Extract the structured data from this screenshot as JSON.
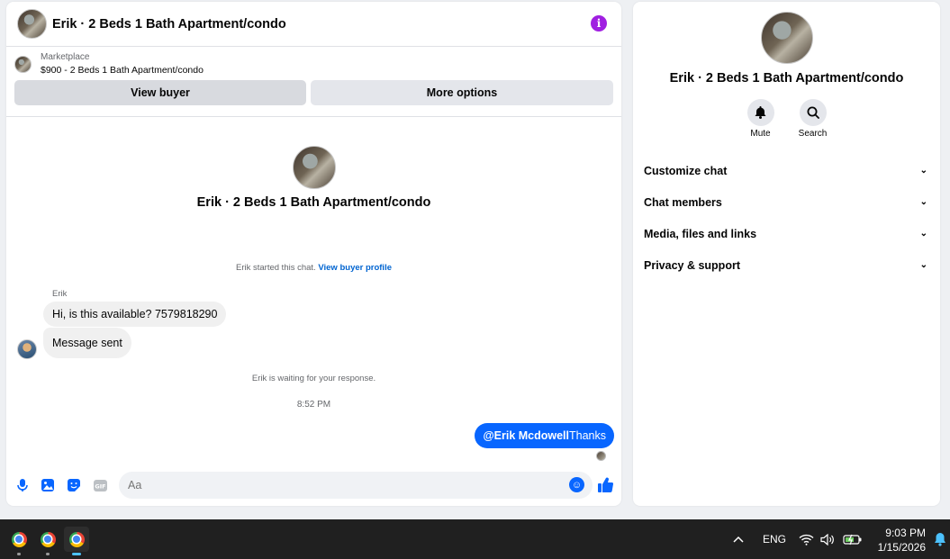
{
  "chat": {
    "header_title": "Erik · 2 Beds 1 Bath Apartment/condo",
    "marketplace": {
      "label": "Marketplace",
      "listing": "$900 - 2 Beds 1 Bath Apartment/condo",
      "view_buyer": "View buyer",
      "more_options": "More options"
    },
    "conversation_name": "Erik · 2 Beds 1 Bath Apartment/condo",
    "started_text": "Erik started this chat.",
    "view_profile_link": "View buyer profile",
    "sender_name": "Erik",
    "messages_in": [
      "Hi, is this available? 7579818290",
      "Message sent"
    ],
    "waiting_text": "Erik is waiting for your response.",
    "timestamp": "8:52 PM",
    "message_out_mention": "@Erik Mcdowell",
    "message_out_text": "Thanks",
    "composer_placeholder": "Aa"
  },
  "side": {
    "name": "Erik · 2 Beds 1 Bath Apartment/condo",
    "actions": [
      "Mute",
      "Search"
    ],
    "sections": [
      "Customize chat",
      "Chat members",
      "Media, files and links",
      "Privacy & support"
    ]
  },
  "taskbar": {
    "language": "ENG",
    "time": "9:03 PM",
    "date": "1/15/2026"
  },
  "colors": {
    "accent": "#0866ff",
    "info": "#a01fe1"
  }
}
